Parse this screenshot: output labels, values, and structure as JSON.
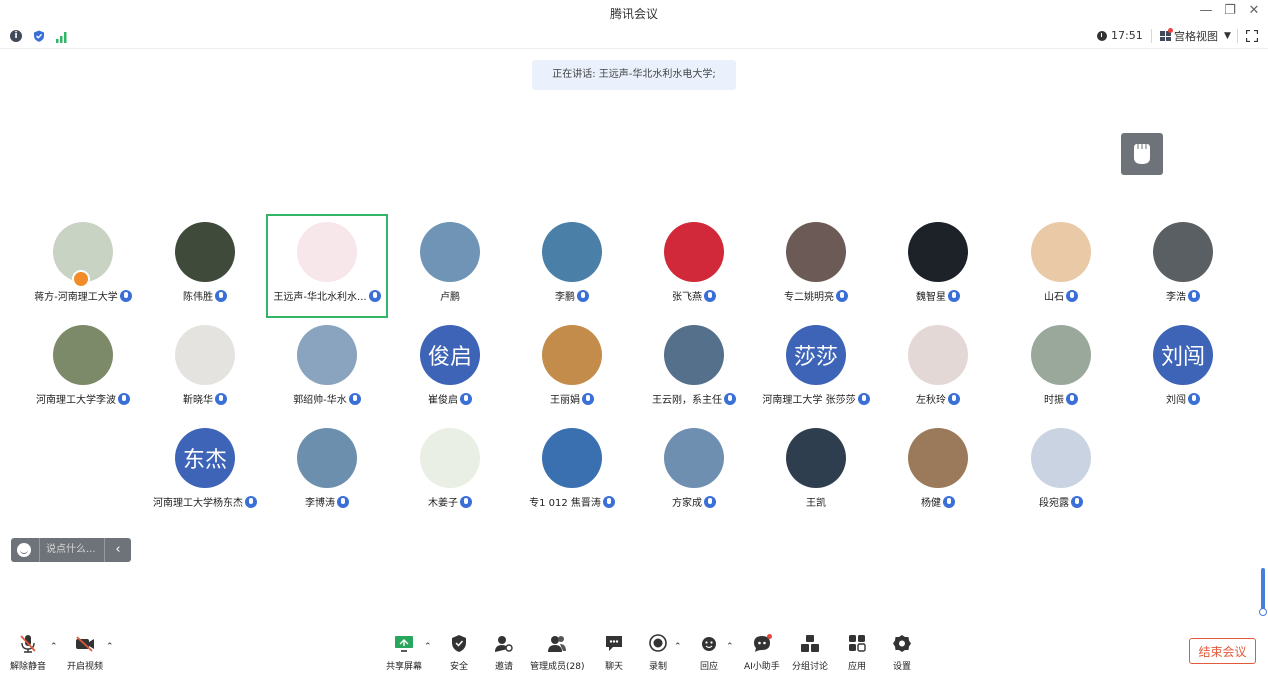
{
  "window": {
    "title": "腾讯会议"
  },
  "statusbar": {
    "time": "17:51",
    "view_label": "宫格视图"
  },
  "speaking": {
    "text": "正在讲话: 王远声-华北水利水电大学;"
  },
  "colors": {
    "accent": "#3a6fd8",
    "active_border": "#33b466",
    "end": "#e25a3b"
  },
  "participants": [
    {
      "name": "蒋方-河南理工大学",
      "avatar_text": "",
      "color": "#c9d3c4",
      "mic": true
    },
    {
      "name": "陈伟胜",
      "avatar_text": "",
      "color": "#3f4a3a",
      "mic": true
    },
    {
      "name": "王远声-华北水利水...",
      "avatar_text": "",
      "color": "#f7e6ea",
      "mic": true,
      "active": true
    },
    {
      "name": "卢鹏",
      "avatar_text": "",
      "color": "#6f94b5",
      "mic": false
    },
    {
      "name": "李鹏",
      "avatar_text": "",
      "color": "#4a7fa8",
      "mic": true
    },
    {
      "name": "张飞燕",
      "avatar_text": "",
      "color": "#d2293a",
      "mic": true
    },
    {
      "name": "专二姚明亮",
      "avatar_text": "",
      "color": "#6b5a55",
      "mic": true
    },
    {
      "name": "魏智星",
      "avatar_text": "",
      "color": "#1d2228",
      "mic": true
    },
    {
      "name": "山石",
      "avatar_text": "",
      "color": "#e9c9a6",
      "mic": true
    },
    {
      "name": "李浩",
      "avatar_text": "",
      "color": "#5a5f63",
      "mic": true
    },
    {
      "name": "河南理工大学李波",
      "avatar_text": "",
      "color": "#7d8a6a",
      "mic": true
    },
    {
      "name": "靳晓华",
      "avatar_text": "",
      "color": "#e5e3df",
      "mic": true
    },
    {
      "name": "郭绍帅-华水",
      "avatar_text": "",
      "color": "#8aa3be",
      "mic": true
    },
    {
      "name": "崔俊启",
      "avatar_text": "俊启",
      "color": "#3d64b7",
      "mic": true
    },
    {
      "name": "王丽娟",
      "avatar_text": "",
      "color": "#c48c4a",
      "mic": true
    },
    {
      "name": "王云刚，系主任",
      "avatar_text": "",
      "color": "#55708a",
      "mic": true
    },
    {
      "name": "河南理工大学 张莎莎",
      "avatar_text": "莎莎",
      "color": "#3d64b7",
      "mic": true
    },
    {
      "name": "左秋玲",
      "avatar_text": "",
      "color": "#e3d8d6",
      "mic": true
    },
    {
      "name": "时振",
      "avatar_text": "",
      "color": "#9aa89c",
      "mic": true
    },
    {
      "name": "刘闯",
      "avatar_text": "刘闯",
      "color": "#3d64b7",
      "mic": true
    },
    {
      "name": "河南理工大学杨东杰",
      "avatar_text": "东杰",
      "color": "#3d64b7",
      "mic": true
    },
    {
      "name": "李博涛",
      "avatar_text": "",
      "color": "#6d8fae",
      "mic": true
    },
    {
      "name": "木姜子",
      "avatar_text": "",
      "color": "#e9efe4",
      "mic": true
    },
    {
      "name": "专1 012 焦晋涛",
      "avatar_text": "",
      "color": "#3a6fb0",
      "mic": true
    },
    {
      "name": "方家成",
      "avatar_text": "",
      "color": "#6f8fb0",
      "mic": true
    },
    {
      "name": "王凯",
      "avatar_text": "",
      "color": "#2f3e4f",
      "mic": false
    },
    {
      "name": "杨健",
      "avatar_text": "",
      "color": "#9a7a5a",
      "mic": true
    },
    {
      "name": "段宛露",
      "avatar_text": "",
      "color": "#c9d3e2",
      "mic": true
    }
  ],
  "chat": {
    "placeholder": "说点什么..."
  },
  "toolbar": {
    "unmute": "解除静音",
    "start_video": "开启视频",
    "share_screen": "共享屏幕",
    "security": "安全",
    "invite": "邀请",
    "manage": "管理成员(28)",
    "chat": "聊天",
    "record": "录制",
    "react": "回应",
    "ai": "AI小助手",
    "breakout": "分组讨论",
    "apps": "应用",
    "settings": "设置",
    "end": "结束会议"
  }
}
